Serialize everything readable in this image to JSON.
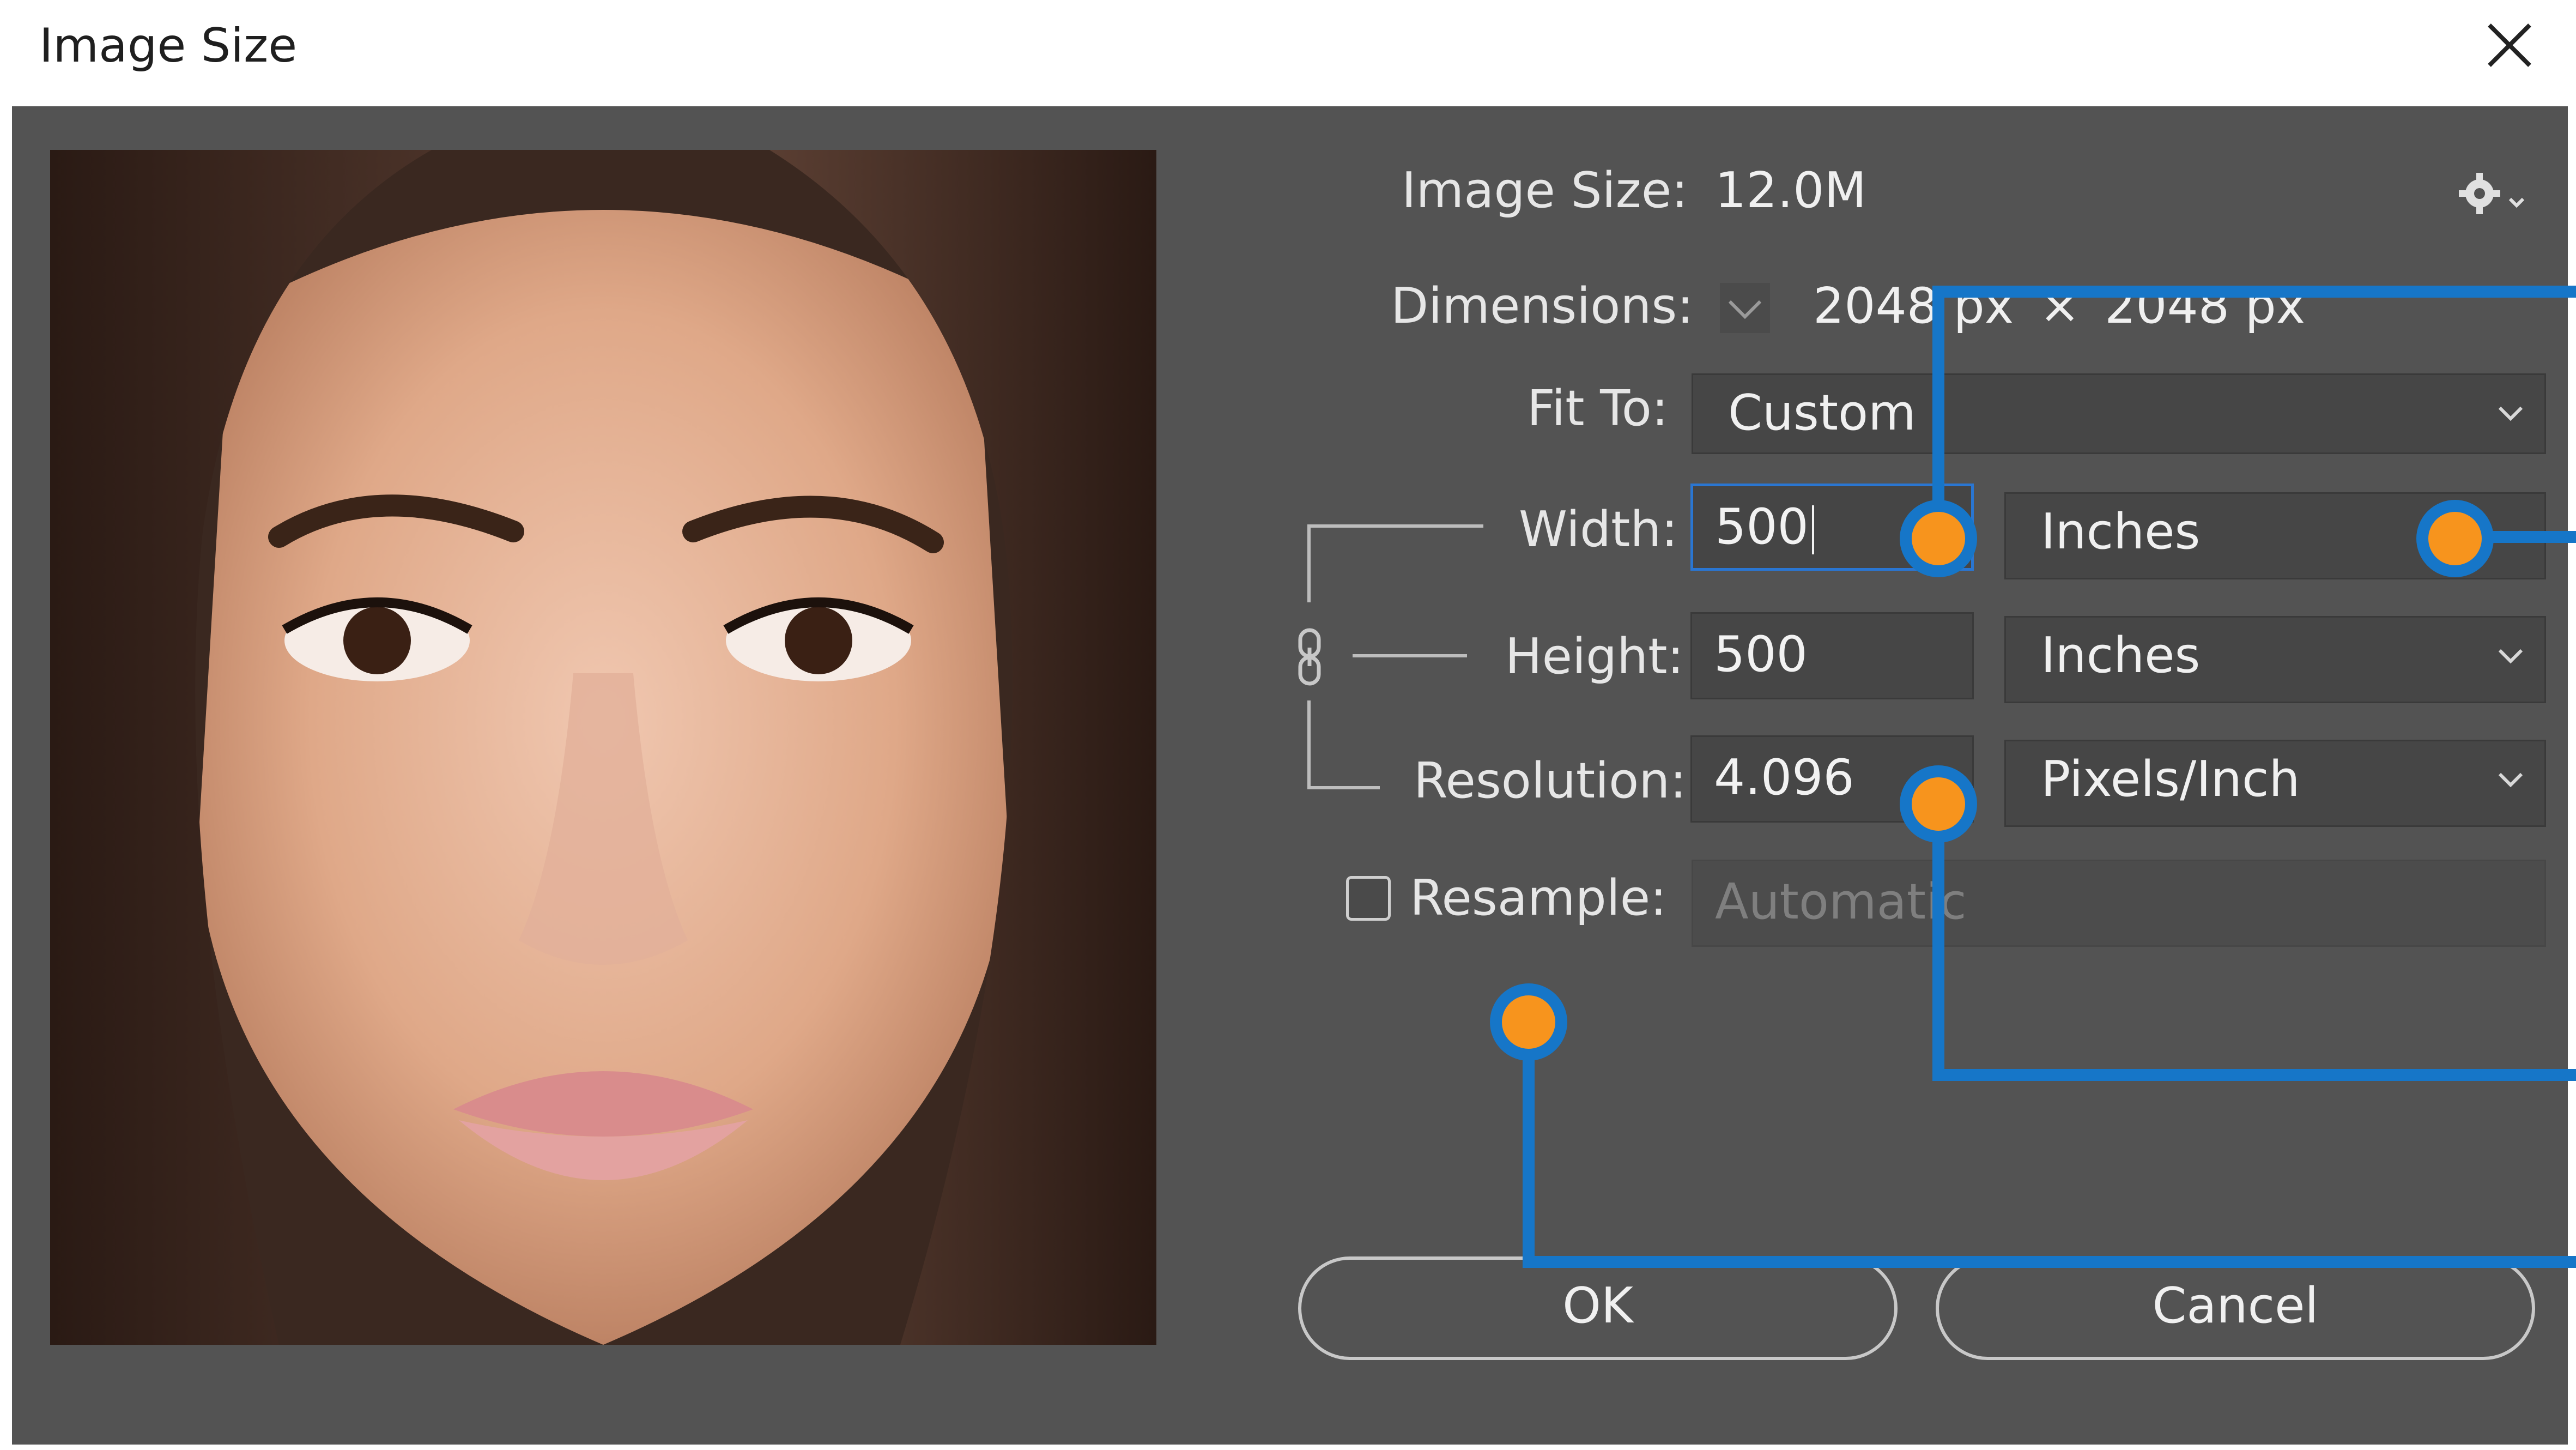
{
  "window": {
    "title": "Image Size"
  },
  "info": {
    "image_size_label": "Image Size:",
    "image_size_value": "12.0M",
    "dimensions_label": "Dimensions:",
    "dimensions_width": "2048 px",
    "dimensions_times": "×",
    "dimensions_height": "2048 px"
  },
  "fit_to": {
    "label": "Fit To:",
    "value": "Custom"
  },
  "width": {
    "label": "Width:",
    "value": "500",
    "unit": "Inches"
  },
  "height": {
    "label": "Height:",
    "value": "500",
    "unit": "Inches"
  },
  "resolution": {
    "label": "Resolution:",
    "value": "4.096",
    "unit": "Pixels/Inch"
  },
  "resample": {
    "label": "Resample:",
    "checked": false,
    "method": "Automatic"
  },
  "buttons": {
    "ok": "OK",
    "cancel": "Cancel"
  },
  "icons": {
    "close": "close-icon",
    "settings": "gear-icon",
    "link": "chain-link-icon",
    "dimensions_menu": "chevron-down-icon"
  },
  "colors": {
    "dialog_bg": "#535353",
    "callout_line": "#1676c8",
    "callout_dot": "#f7941d",
    "focus_border": "#2a76d2"
  }
}
